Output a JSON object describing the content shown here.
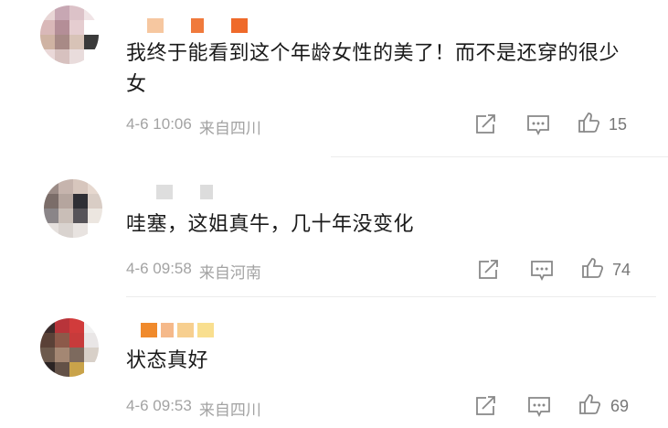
{
  "comments": [
    {
      "text": "我终于能看到这个年龄女性的美了！而不是还穿的很少女",
      "date": "4-6 10:06",
      "location": "来自四川",
      "likes": "15",
      "name_colors": [
        "#f6c7a0",
        "#f07a3c",
        "#ef6a2a"
      ],
      "avatar_colors": [
        "#e8d5d5",
        "#c7a7b3",
        "#dcc2c8",
        "#f0e4e6",
        "#d9b8b8",
        "#b48e97",
        "#e5cdd0",
        "#ffffff",
        "#cfb3a3",
        "#a88a86",
        "#d8c3b7",
        "#3a3a3a",
        "#ead8d8",
        "#d7c1bf",
        "#e9dcdc",
        "#ffffff"
      ]
    },
    {
      "text": "哇塞，这姐真牛，几十年没变化",
      "date": "4-6 09:58",
      "location": "来自河南",
      "likes": "74",
      "name_colors": [
        "#dedede",
        "#dcdcdc"
      ],
      "avatar_colors": [
        "#9b8b86",
        "#c6b4ad",
        "#d7c6bd",
        "#e6d8cf",
        "#7b6d69",
        "#b5a59e",
        "#2f2f35",
        "#d9cdc5",
        "#8a8588",
        "#c9beb7",
        "#575459",
        "#ece6e0",
        "#e5e0dd",
        "#d9d3cf",
        "#e8e3e0",
        "#ffffff"
      ]
    },
    {
      "text": "状态真好",
      "date": "4-6 09:53",
      "location": "来自四川",
      "likes": "69",
      "name_colors": [
        "#f08a2c",
        "#f5b98a",
        "#f7cf8f",
        "#f9df8f"
      ],
      "avatar_colors": [
        "#3b2a2a",
        "#b8343a",
        "#d13b3b",
        "#f1f1f1",
        "#5a4137",
        "#8c5a4a",
        "#c73b3b",
        "#e9e6e6",
        "#6d5a4d",
        "#a48773",
        "#7d6a5e",
        "#d8d0c8",
        "#2b2424",
        "#635147",
        "#c9a34a",
        "#ffffff"
      ]
    }
  ],
  "icons": {
    "share": "share-icon",
    "comment": "comment-icon",
    "like": "thumbs-up-icon"
  }
}
